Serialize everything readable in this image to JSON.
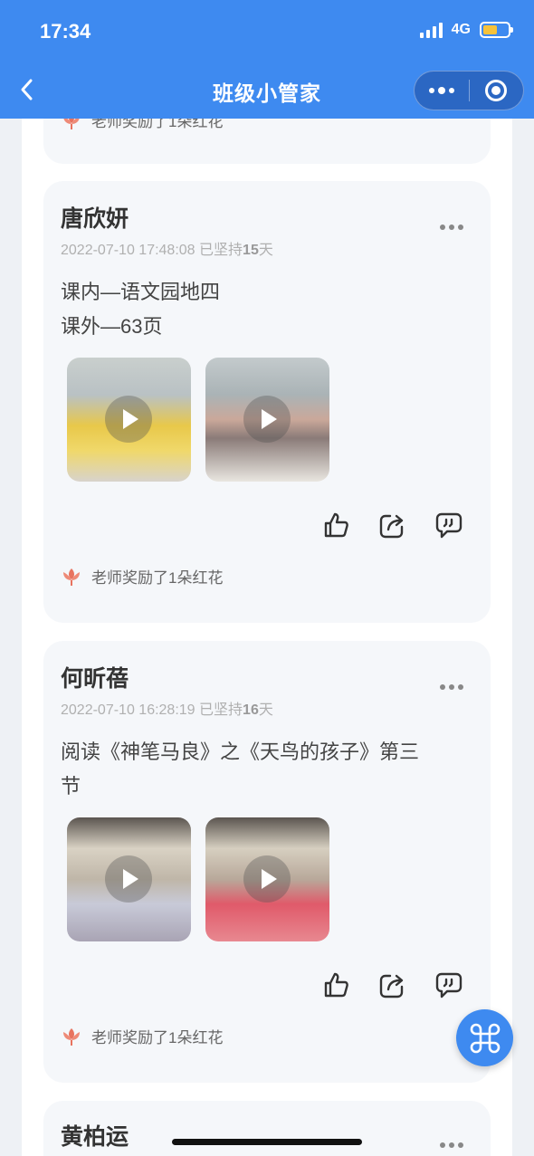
{
  "status_bar": {
    "time": "17:34",
    "network": "4G"
  },
  "nav": {
    "title": "班级小管家"
  },
  "top_partial": {
    "reward_text": "老师奖励了1朵红花"
  },
  "posts": [
    {
      "name": "唐欣妍",
      "date": "2022-07-10 17:48:08",
      "streak_prefix": "已坚持",
      "streak_days": "15",
      "streak_suffix": "天",
      "content_lines": [
        "课内—语文园地四",
        "课外—63页"
      ],
      "reward_text": "老师奖励了1朵红花"
    },
    {
      "name": "何昕蓓",
      "date": "2022-07-10 16:28:19",
      "streak_prefix": "已坚持",
      "streak_days": "16",
      "streak_suffix": "天",
      "content_lines": [
        "阅读《神笔马良》之《天鸟的孩子》第三",
        "节"
      ],
      "reward_text": "老师奖励了1朵红花"
    },
    {
      "name": "黄柏运"
    }
  ],
  "colors": {
    "brand": "#3e8af0",
    "flower": "#e8735f"
  }
}
